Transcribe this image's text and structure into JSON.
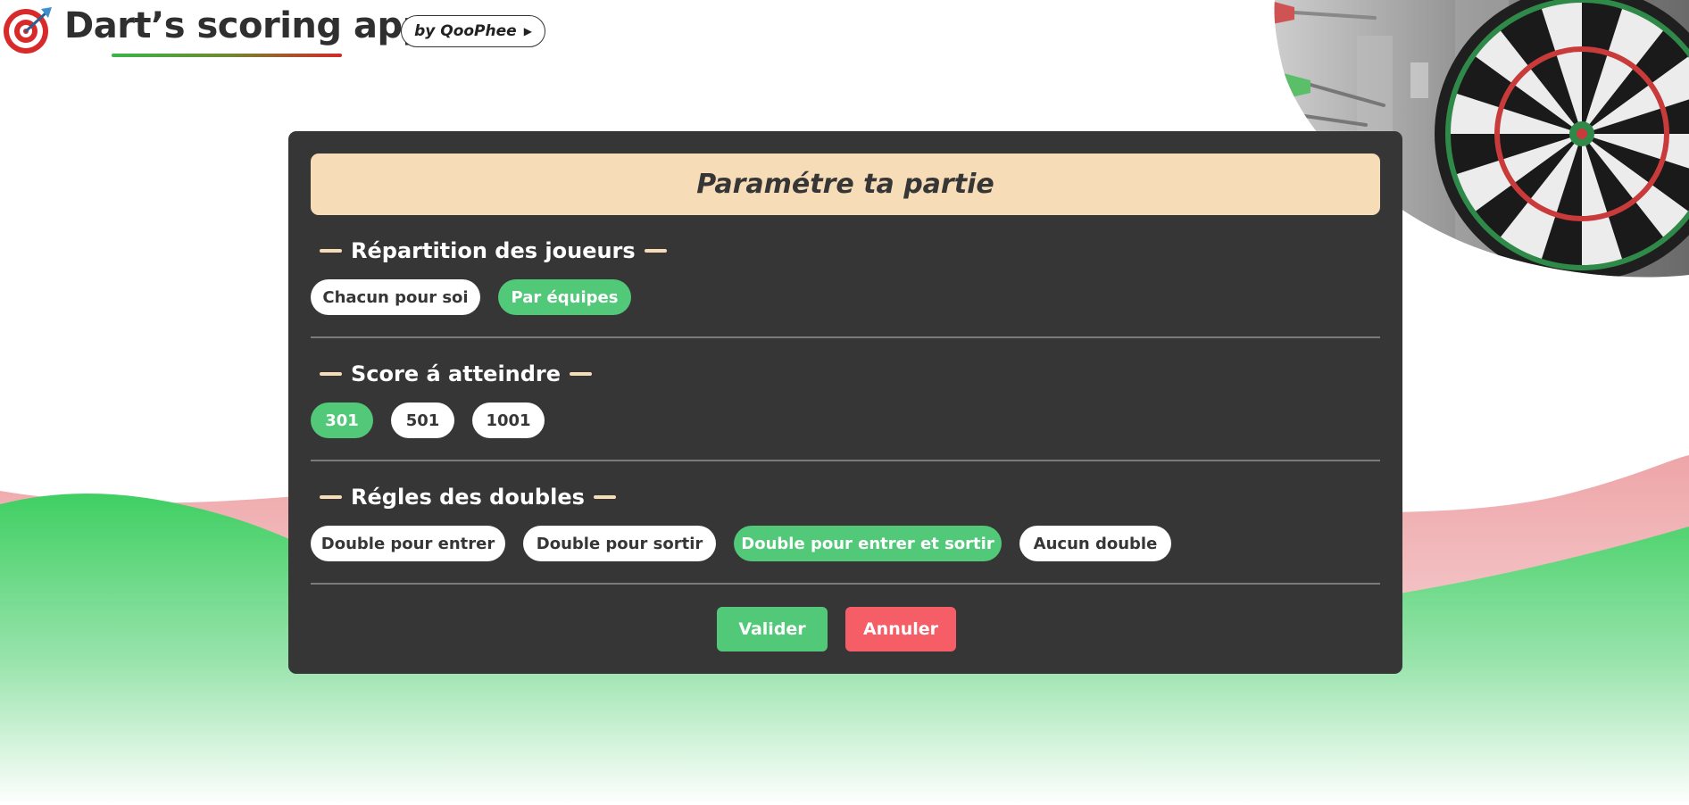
{
  "header": {
    "app_title": "Dart’s scoring app",
    "author_badge": "by QooPhee",
    "logo_icon": "dartboard-target-icon",
    "badge_icon": "play-triangle-icon"
  },
  "panel": {
    "title": "Paramétre ta partie",
    "sections": [
      {
        "title": "Répartition des joueurs",
        "options": [
          {
            "label": "Chacun pour soi",
            "selected": false
          },
          {
            "label": "Par équipes",
            "selected": true
          }
        ]
      },
      {
        "title": "Score á atteindre",
        "options": [
          {
            "label": "301",
            "selected": true
          },
          {
            "label": "501",
            "selected": false
          },
          {
            "label": "1001",
            "selected": false
          }
        ]
      },
      {
        "title": "Régles des doubles",
        "options": [
          {
            "label": "Double pour entrer",
            "selected": false
          },
          {
            "label": "Double pour sortir",
            "selected": false
          },
          {
            "label": "Double pour entrer et sortir",
            "selected": true
          },
          {
            "label": "Aucun double",
            "selected": false
          }
        ]
      }
    ],
    "actions": {
      "validate": "Valider",
      "cancel": "Annuler"
    }
  },
  "colors": {
    "panel_bg": "#363636",
    "header_bg": "#f6dcb7",
    "selected": "#52c879",
    "cancel": "#f65e67",
    "background_green": "#3fcf62",
    "background_pink": "#eea5a8"
  }
}
